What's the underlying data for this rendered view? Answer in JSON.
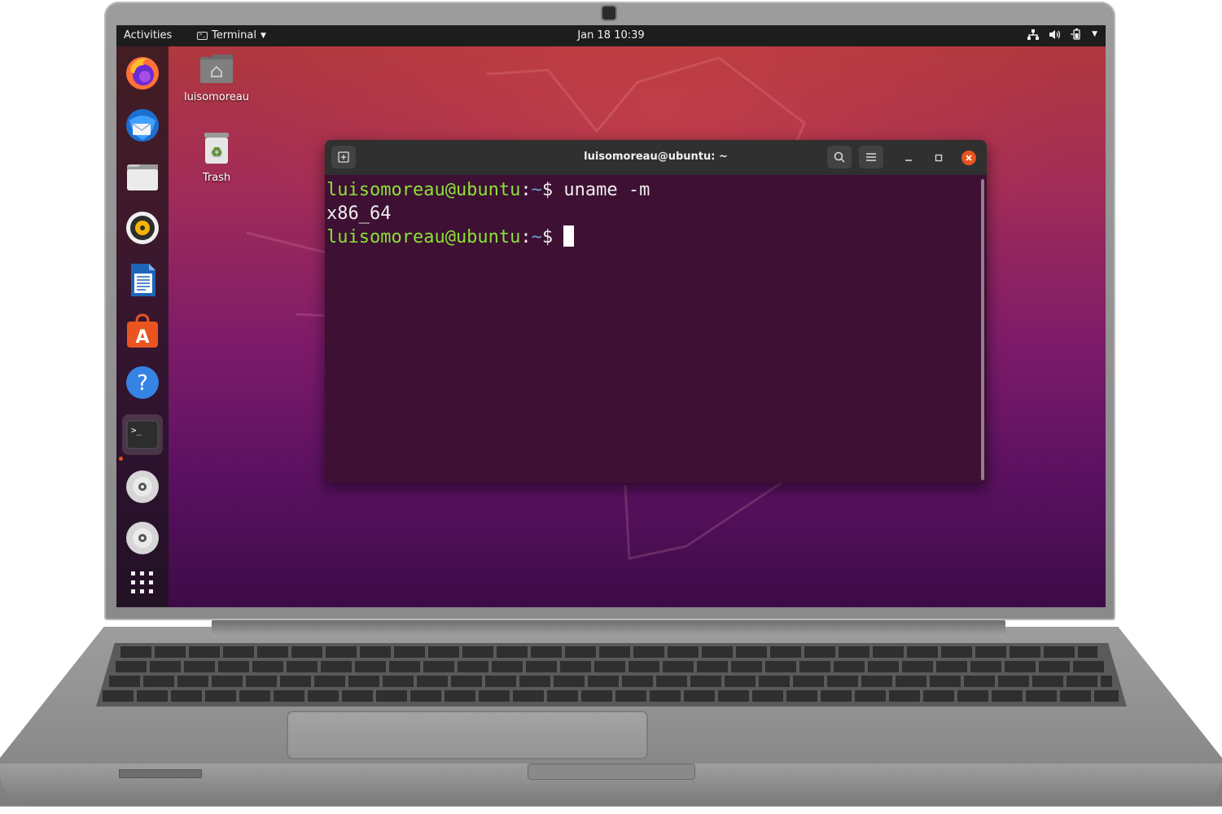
{
  "topbar": {
    "activities": "Activities",
    "app_menu": "Terminal",
    "clock": "Jan 18  10:39"
  },
  "dock": {
    "items": [
      {
        "name": "Firefox",
        "icon": "firefox-icon"
      },
      {
        "name": "Thunderbird",
        "icon": "thunderbird-icon"
      },
      {
        "name": "Files",
        "icon": "files-icon"
      },
      {
        "name": "Rhythmbox",
        "icon": "rhythmbox-icon"
      },
      {
        "name": "LibreOffice Writer",
        "icon": "writer-icon"
      },
      {
        "name": "Ubuntu Software",
        "icon": "software-icon"
      },
      {
        "name": "Help",
        "icon": "help-icon"
      },
      {
        "name": "Terminal",
        "icon": "terminal-icon",
        "active": true
      },
      {
        "name": "Disc 1",
        "icon": "disc-icon"
      },
      {
        "name": "Disc 2",
        "icon": "disc-icon"
      },
      {
        "name": "Show Applications",
        "icon": "app-grid-icon"
      }
    ]
  },
  "desktop": {
    "home_label": "luisomoreau",
    "trash_label": "Trash"
  },
  "terminal": {
    "title": "luisomoreau@ubuntu: ~",
    "user_host": "luisomoreau@ubuntu",
    "separator": ":",
    "path": "~",
    "prompt_symbol": "$ ",
    "command": "uname -m",
    "output": "x86_64"
  },
  "colors": {
    "prompt_user": "#8ae234",
    "prompt_path": "#729fcf",
    "terminal_bg": "#3e1034",
    "close_button": "#e95420"
  }
}
